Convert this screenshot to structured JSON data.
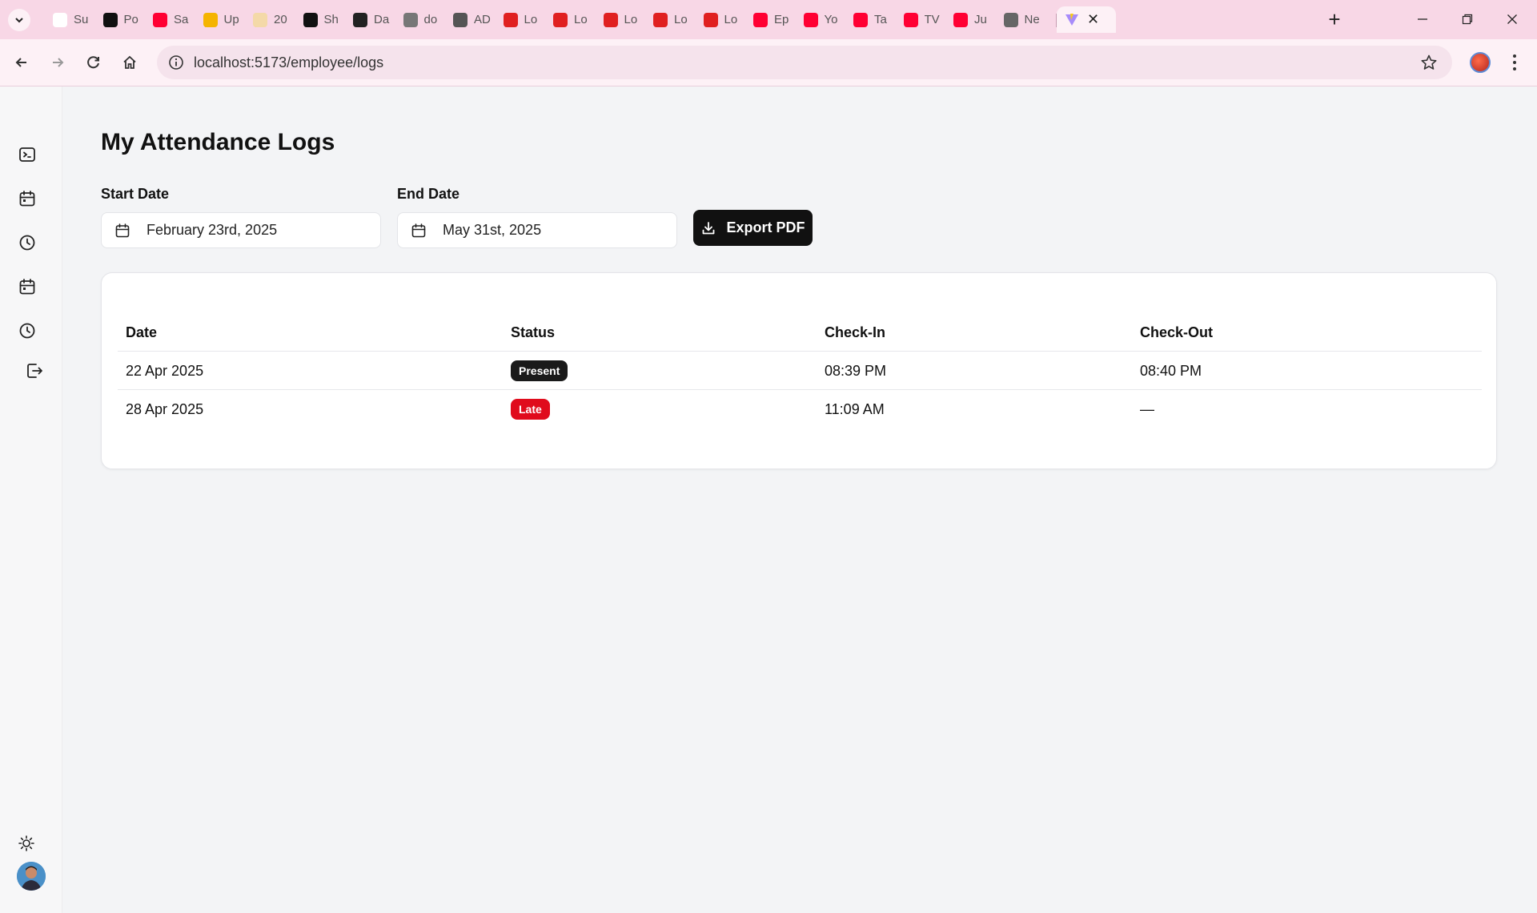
{
  "browser": {
    "tabs": [
      {
        "title": "Su",
        "icon": "tab-favicon-generic",
        "color": "#ffffff"
      },
      {
        "title": "Po",
        "icon": "openai-favicon",
        "color": "#111111"
      },
      {
        "title": "Sa",
        "icon": "youtube-favicon",
        "color": "#ff0033"
      },
      {
        "title": "Up",
        "icon": "stack-favicon",
        "color": "#f5b400"
      },
      {
        "title": "20",
        "icon": "tab-favicon-generic",
        "color": "#f4d9a8"
      },
      {
        "title": "Sh",
        "icon": "a-favicon",
        "color": "#111111"
      },
      {
        "title": "Da",
        "icon": "pen-favicon",
        "color": "#222222"
      },
      {
        "title": "do",
        "icon": "d-favicon",
        "color": "#777777"
      },
      {
        "title": "AD",
        "icon": "globe-favicon",
        "color": "#555555"
      },
      {
        "title": "Lo",
        "icon": "red-doc-favicon",
        "color": "#e02020"
      },
      {
        "title": "Lo",
        "icon": "red-doc-favicon",
        "color": "#e02020"
      },
      {
        "title": "Lo",
        "icon": "red-doc-favicon",
        "color": "#e02020"
      },
      {
        "title": "Lo",
        "icon": "red-doc-favicon",
        "color": "#e02020"
      },
      {
        "title": "Lo",
        "icon": "red-doc-favicon",
        "color": "#e02020"
      },
      {
        "title": "Ep",
        "icon": "youtube-favicon",
        "color": "#ff0033"
      },
      {
        "title": "Yo",
        "icon": "youtube-favicon",
        "color": "#ff0033"
      },
      {
        "title": "Ta",
        "icon": "youtube-favicon",
        "color": "#ff0033"
      },
      {
        "title": "TV",
        "icon": "youtube-favicon",
        "color": "#ff0033"
      },
      {
        "title": "Ju",
        "icon": "youtube-favicon",
        "color": "#ff0033"
      },
      {
        "title": "Ne",
        "icon": "chrome-favicon",
        "color": "#666666"
      }
    ],
    "url": "localhost:5173/employee/logs"
  },
  "page": {
    "title": "My Attendance Logs",
    "start_date_label": "Start Date",
    "start_date_value": "February 23rd, 2025",
    "end_date_label": "End Date",
    "end_date_value": "May 31st, 2025",
    "export_label": "Export PDF"
  },
  "table": {
    "headers": [
      "Date",
      "Status",
      "Check-In",
      "Check-Out"
    ],
    "rows": [
      {
        "date": "22 Apr 2025",
        "status": "Present",
        "status_color": "#1a1a1a",
        "check_in": "08:39 PM",
        "check_out": "08:40 PM"
      },
      {
        "date": "28 Apr 2025",
        "status": "Late",
        "status_color": "#e00b1c",
        "check_in": "11:09 AM",
        "check_out": "—"
      }
    ]
  },
  "sidebar": {
    "items": [
      "terminal-icon",
      "calendar-icon",
      "clock-icon",
      "calendar-icon",
      "clock-icon",
      "logout-icon"
    ],
    "theme_icon": "sun-icon"
  }
}
